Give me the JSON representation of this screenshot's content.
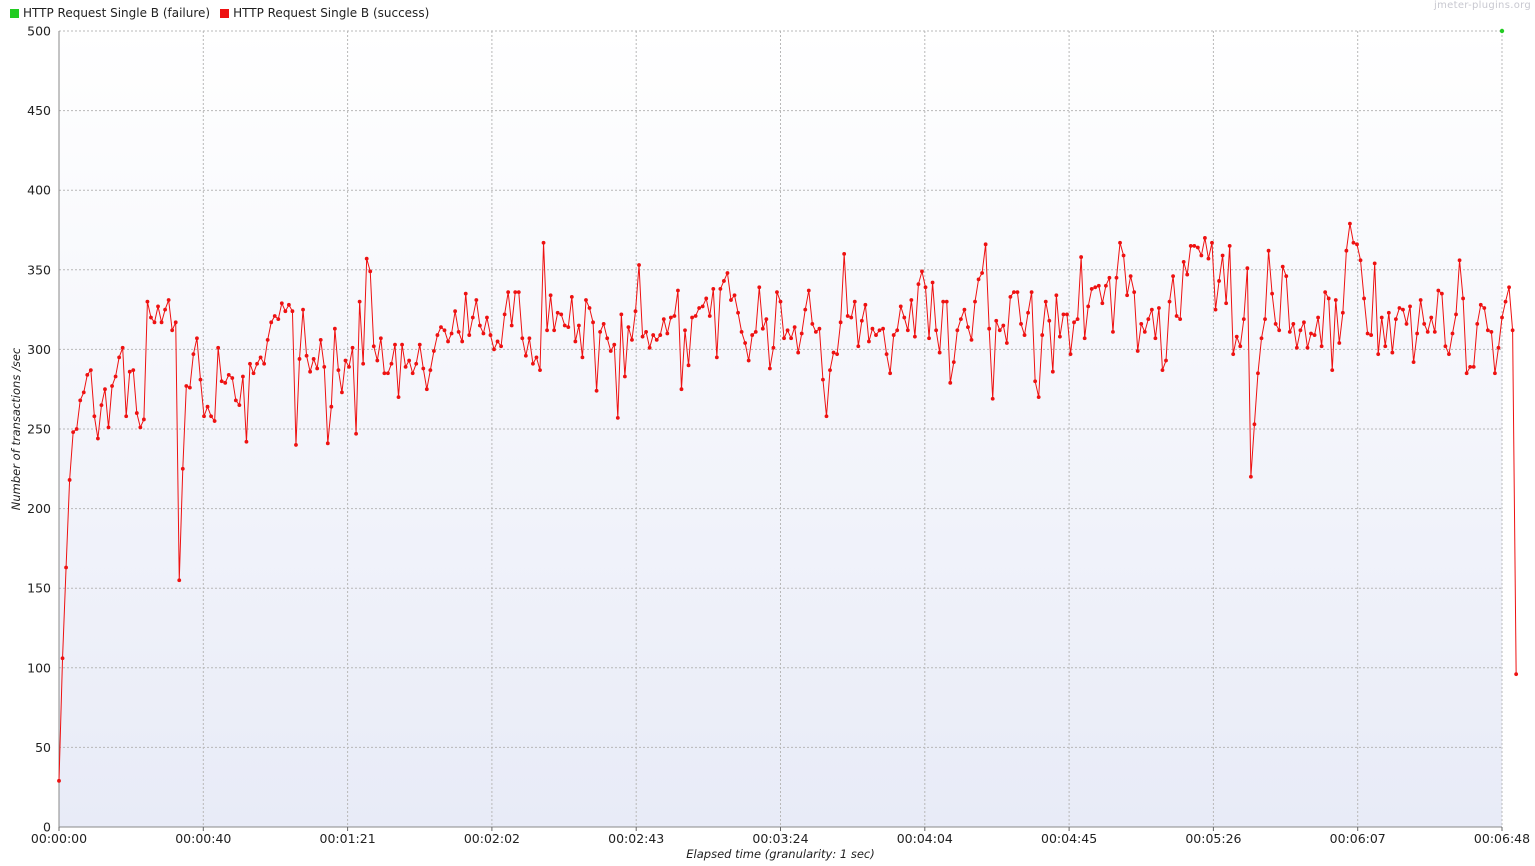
{
  "watermark": "jmeter-plugins.org",
  "chart_data": {
    "type": "line",
    "title": "",
    "xlabel": "Elapsed time (granularity: 1 sec)",
    "ylabel": "Number of transactions /sec",
    "ylim": [
      0,
      500
    ],
    "xlim": [
      0,
      408
    ],
    "x_unit": "seconds",
    "grid": true,
    "legend_position": "top-left",
    "y_ticks": [
      0,
      50,
      100,
      150,
      200,
      250,
      300,
      350,
      400,
      450,
      500
    ],
    "x_tick_labels": [
      "00:00:00",
      "00:00:40",
      "00:01:21",
      "00:02:02",
      "00:02:43",
      "00:03:24",
      "00:04:04",
      "00:04:45",
      "00:05:26",
      "00:06:07",
      "00:06:48"
    ],
    "series": [
      {
        "name": "HTTP Request Single B (failure)",
        "color": "#22cc22",
        "points": [
          [
            408,
            500
          ]
        ]
      },
      {
        "name": "HTTP Request Single B (success)",
        "color": "#ee1111",
        "values": [
          29,
          106,
          163,
          218,
          248,
          250,
          268,
          273,
          284,
          287,
          258,
          244,
          265,
          275,
          251,
          277,
          283,
          295,
          301,
          258,
          286,
          287,
          260,
          251,
          256,
          330,
          320,
          317,
          327,
          317,
          325,
          331,
          312,
          317,
          155,
          225,
          277,
          276,
          297,
          307,
          281,
          258,
          264,
          258,
          255,
          301,
          280,
          279,
          284,
          282,
          268,
          265,
          283,
          242,
          291,
          285,
          291,
          295,
          291,
          306,
          317,
          321,
          319,
          329,
          324,
          328,
          324,
          240,
          294,
          325,
          296,
          286,
          294,
          288,
          306,
          289,
          241,
          264,
          313,
          287,
          273,
          293,
          289,
          301,
          247,
          330,
          291,
          357,
          349,
          302,
          293,
          307,
          285,
          285,
          291,
          303,
          270,
          303,
          289,
          293,
          285,
          291,
          303,
          288,
          275,
          287,
          299,
          309,
          314,
          312,
          305,
          310,
          324,
          311,
          305,
          335,
          309,
          320,
          331,
          315,
          310,
          320,
          309,
          300,
          305,
          302,
          322,
          336,
          315,
          336,
          336,
          307,
          296,
          307,
          291,
          295,
          287,
          367,
          312,
          334,
          312,
          323,
          322,
          315,
          314,
          333,
          305,
          315,
          295,
          331,
          326,
          317,
          274,
          311,
          316,
          307,
          299,
          303,
          257,
          322,
          283,
          314,
          306,
          324,
          353,
          308,
          311,
          301,
          309,
          306,
          309,
          319,
          310,
          320,
          321,
          337,
          275,
          312,
          290,
          320,
          321,
          326,
          327,
          332,
          321,
          338,
          295,
          338,
          343,
          348,
          331,
          334,
          323,
          311,
          304,
          293,
          309,
          311,
          339,
          313,
          319,
          288,
          301,
          336,
          330,
          307,
          312,
          307,
          314,
          298,
          310,
          325,
          337,
          316,
          311,
          313,
          281,
          258,
          287,
          298,
          297,
          317,
          360,
          321,
          320,
          330,
          302,
          318,
          328,
          305,
          313,
          309,
          312,
          313,
          297,
          285,
          309,
          312,
          327,
          320,
          312,
          331,
          308,
          341,
          349,
          339,
          307,
          342,
          312,
          298,
          330,
          330,
          279,
          292,
          312,
          319,
          325,
          314,
          306,
          330,
          344,
          348,
          366,
          313,
          269,
          318,
          312,
          315,
          304,
          333,
          336,
          336,
          316,
          309,
          323,
          336,
          280,
          270,
          309,
          330,
          318,
          286,
          334,
          308,
          322,
          322,
          297,
          317,
          319,
          358,
          307,
          327,
          338,
          339,
          340,
          329,
          340,
          345,
          311,
          345,
          367,
          359,
          334,
          346,
          336,
          299,
          316,
          311,
          319,
          325,
          307,
          326,
          287,
          293,
          330,
          346,
          321,
          319,
          355,
          347,
          365,
          365,
          364,
          359,
          370,
          357,
          367,
          325,
          343,
          359,
          329,
          365,
          297,
          308,
          302,
          319,
          351,
          220,
          253,
          285,
          307,
          319,
          362,
          335,
          316,
          312,
          352,
          346,
          311,
          316,
          301,
          312,
          317,
          301,
          310,
          309,
          320,
          302,
          336,
          332,
          287,
          331,
          304,
          323,
          362,
          379,
          367,
          366,
          356,
          332,
          310,
          309,
          354,
          297,
          320,
          302,
          323,
          298,
          319,
          326,
          325,
          316,
          327,
          292,
          310,
          331,
          316,
          311,
          320,
          311,
          337,
          335,
          302,
          297,
          310,
          322,
          356,
          332,
          285,
          289,
          289,
          316,
          328,
          326,
          312,
          311,
          285,
          301,
          320,
          330,
          339,
          312,
          96
        ]
      }
    ]
  }
}
